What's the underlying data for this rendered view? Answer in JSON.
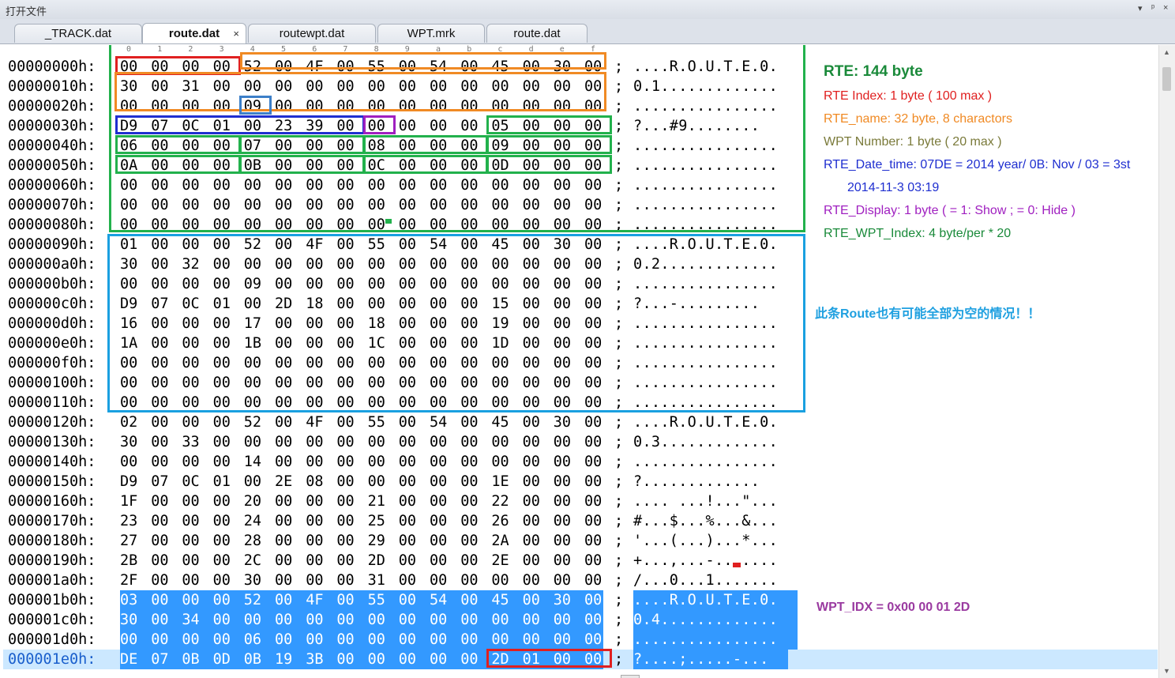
{
  "window": {
    "title": "打开文件",
    "controls": "▾ ᵖ ×"
  },
  "tabs": [
    {
      "label": "_TRACK.dat",
      "active": false
    },
    {
      "label": "route.dat",
      "active": true,
      "close": "×"
    },
    {
      "label": "routewpt.dat",
      "active": false
    },
    {
      "label": "WPT.mrk",
      "active": false
    },
    {
      "label": "route.dat",
      "active": false
    }
  ],
  "ruler": [
    "0",
    "1",
    "2",
    "3",
    "4",
    "5",
    "6",
    "7",
    "8",
    "9",
    "a",
    "b",
    "c",
    "d",
    "e",
    "f"
  ],
  "hex_rows": [
    {
      "addr": "00000000h:",
      "bytes": [
        "00",
        "00",
        "00",
        "00",
        "52",
        "00",
        "4F",
        "00",
        "55",
        "00",
        "54",
        "00",
        "45",
        "00",
        "30",
        "00"
      ],
      "ascii": "....R.O.U.T.E.0."
    },
    {
      "addr": "00000010h:",
      "bytes": [
        "30",
        "00",
        "31",
        "00",
        "00",
        "00",
        "00",
        "00",
        "00",
        "00",
        "00",
        "00",
        "00",
        "00",
        "00",
        "00"
      ],
      "ascii": "0.1............."
    },
    {
      "addr": "00000020h:",
      "bytes": [
        "00",
        "00",
        "00",
        "00",
        "09",
        "00",
        "00",
        "00",
        "00",
        "00",
        "00",
        "00",
        "00",
        "00",
        "00",
        "00"
      ],
      "ascii": "................"
    },
    {
      "addr": "00000030h:",
      "bytes": [
        "D9",
        "07",
        "0C",
        "01",
        "00",
        "23",
        "39",
        "00",
        "00",
        "00",
        "00",
        "00",
        "05",
        "00",
        "00",
        "00"
      ],
      "ascii": "?...#9........"
    },
    {
      "addr": "00000040h:",
      "bytes": [
        "06",
        "00",
        "00",
        "00",
        "07",
        "00",
        "00",
        "00",
        "08",
        "00",
        "00",
        "00",
        "09",
        "00",
        "00",
        "00"
      ],
      "ascii": "................"
    },
    {
      "addr": "00000050h:",
      "bytes": [
        "0A",
        "00",
        "00",
        "00",
        "0B",
        "00",
        "00",
        "00",
        "0C",
        "00",
        "00",
        "00",
        "0D",
        "00",
        "00",
        "00"
      ],
      "ascii": "................"
    },
    {
      "addr": "00000060h:",
      "bytes": [
        "00",
        "00",
        "00",
        "00",
        "00",
        "00",
        "00",
        "00",
        "00",
        "00",
        "00",
        "00",
        "00",
        "00",
        "00",
        "00"
      ],
      "ascii": "................"
    },
    {
      "addr": "00000070h:",
      "bytes": [
        "00",
        "00",
        "00",
        "00",
        "00",
        "00",
        "00",
        "00",
        "00",
        "00",
        "00",
        "00",
        "00",
        "00",
        "00",
        "00"
      ],
      "ascii": "................"
    },
    {
      "addr": "00000080h:",
      "bytes": [
        "00",
        "00",
        "00",
        "00",
        "00",
        "00",
        "00",
        "00",
        "00",
        "00",
        "00",
        "00",
        "00",
        "00",
        "00",
        "00"
      ],
      "ascii": "................"
    },
    {
      "addr": "00000090h:",
      "bytes": [
        "01",
        "00",
        "00",
        "00",
        "52",
        "00",
        "4F",
        "00",
        "55",
        "00",
        "54",
        "00",
        "45",
        "00",
        "30",
        "00"
      ],
      "ascii": "....R.O.U.T.E.0."
    },
    {
      "addr": "000000a0h:",
      "bytes": [
        "30",
        "00",
        "32",
        "00",
        "00",
        "00",
        "00",
        "00",
        "00",
        "00",
        "00",
        "00",
        "00",
        "00",
        "00",
        "00"
      ],
      "ascii": "0.2............."
    },
    {
      "addr": "000000b0h:",
      "bytes": [
        "00",
        "00",
        "00",
        "00",
        "09",
        "00",
        "00",
        "00",
        "00",
        "00",
        "00",
        "00",
        "00",
        "00",
        "00",
        "00"
      ],
      "ascii": "................"
    },
    {
      "addr": "000000c0h:",
      "bytes": [
        "D9",
        "07",
        "0C",
        "01",
        "00",
        "2D",
        "18",
        "00",
        "00",
        "00",
        "00",
        "00",
        "15",
        "00",
        "00",
        "00"
      ],
      "ascii": "?...-........."
    },
    {
      "addr": "000000d0h:",
      "bytes": [
        "16",
        "00",
        "00",
        "00",
        "17",
        "00",
        "00",
        "00",
        "18",
        "00",
        "00",
        "00",
        "19",
        "00",
        "00",
        "00"
      ],
      "ascii": "................"
    },
    {
      "addr": "000000e0h:",
      "bytes": [
        "1A",
        "00",
        "00",
        "00",
        "1B",
        "00",
        "00",
        "00",
        "1C",
        "00",
        "00",
        "00",
        "1D",
        "00",
        "00",
        "00"
      ],
      "ascii": "................"
    },
    {
      "addr": "000000f0h:",
      "bytes": [
        "00",
        "00",
        "00",
        "00",
        "00",
        "00",
        "00",
        "00",
        "00",
        "00",
        "00",
        "00",
        "00",
        "00",
        "00",
        "00"
      ],
      "ascii": "................"
    },
    {
      "addr": "00000100h:",
      "bytes": [
        "00",
        "00",
        "00",
        "00",
        "00",
        "00",
        "00",
        "00",
        "00",
        "00",
        "00",
        "00",
        "00",
        "00",
        "00",
        "00"
      ],
      "ascii": "................"
    },
    {
      "addr": "00000110h:",
      "bytes": [
        "00",
        "00",
        "00",
        "00",
        "00",
        "00",
        "00",
        "00",
        "00",
        "00",
        "00",
        "00",
        "00",
        "00",
        "00",
        "00"
      ],
      "ascii": "................"
    },
    {
      "addr": "00000120h:",
      "bytes": [
        "02",
        "00",
        "00",
        "00",
        "52",
        "00",
        "4F",
        "00",
        "55",
        "00",
        "54",
        "00",
        "45",
        "00",
        "30",
        "00"
      ],
      "ascii": "....R.O.U.T.E.0."
    },
    {
      "addr": "00000130h:",
      "bytes": [
        "30",
        "00",
        "33",
        "00",
        "00",
        "00",
        "00",
        "00",
        "00",
        "00",
        "00",
        "00",
        "00",
        "00",
        "00",
        "00"
      ],
      "ascii": "0.3............."
    },
    {
      "addr": "00000140h:",
      "bytes": [
        "00",
        "00",
        "00",
        "00",
        "14",
        "00",
        "00",
        "00",
        "00",
        "00",
        "00",
        "00",
        "00",
        "00",
        "00",
        "00"
      ],
      "ascii": "................"
    },
    {
      "addr": "00000150h:",
      "bytes": [
        "D9",
        "07",
        "0C",
        "01",
        "00",
        "2E",
        "08",
        "00",
        "00",
        "00",
        "00",
        "00",
        "1E",
        "00",
        "00",
        "00"
      ],
      "ascii": "?............."
    },
    {
      "addr": "00000160h:",
      "bytes": [
        "1F",
        "00",
        "00",
        "00",
        "20",
        "00",
        "00",
        "00",
        "21",
        "00",
        "00",
        "00",
        "22",
        "00",
        "00",
        "00"
      ],
      "ascii": ".... ...!...\"..."
    },
    {
      "addr": "00000170h:",
      "bytes": [
        "23",
        "00",
        "00",
        "00",
        "24",
        "00",
        "00",
        "00",
        "25",
        "00",
        "00",
        "00",
        "26",
        "00",
        "00",
        "00"
      ],
      "ascii": "#...$...%...&..."
    },
    {
      "addr": "00000180h:",
      "bytes": [
        "27",
        "00",
        "00",
        "00",
        "28",
        "00",
        "00",
        "00",
        "29",
        "00",
        "00",
        "00",
        "2A",
        "00",
        "00",
        "00"
      ],
      "ascii": "'...(...)...*..."
    },
    {
      "addr": "00000190h:",
      "bytes": [
        "2B",
        "00",
        "00",
        "00",
        "2C",
        "00",
        "00",
        "00",
        "2D",
        "00",
        "00",
        "00",
        "2E",
        "00",
        "00",
        "00"
      ],
      "ascii": "+...,...-......."
    },
    {
      "addr": "000001a0h:",
      "bytes": [
        "2F",
        "00",
        "00",
        "00",
        "30",
        "00",
        "00",
        "00",
        "31",
        "00",
        "00",
        "00",
        "00",
        "00",
        "00",
        "00"
      ],
      "ascii": "/...0...1......."
    },
    {
      "addr": "000001b0h:",
      "bytes": [
        "03",
        "00",
        "00",
        "00",
        "52",
        "00",
        "4F",
        "00",
        "55",
        "00",
        "54",
        "00",
        "45",
        "00",
        "30",
        "00"
      ],
      "ascii": "....R.O.U.T.E.0."
    },
    {
      "addr": "000001c0h:",
      "bytes": [
        "30",
        "00",
        "34",
        "00",
        "00",
        "00",
        "00",
        "00",
        "00",
        "00",
        "00",
        "00",
        "00",
        "00",
        "00",
        "00"
      ],
      "ascii": "0.4............."
    },
    {
      "addr": "000001d0h:",
      "bytes": [
        "00",
        "00",
        "00",
        "00",
        "06",
        "00",
        "00",
        "00",
        "00",
        "00",
        "00",
        "00",
        "00",
        "00",
        "00",
        "00"
      ],
      "ascii": "................"
    },
    {
      "addr": "000001e0h:",
      "bytes": [
        "DE",
        "07",
        "0B",
        "0D",
        "0B",
        "19",
        "3B",
        "00",
        "00",
        "00",
        "00",
        "00",
        "2D",
        "01",
        "00",
        "00"
      ],
      "ascii": "?....;.....-..."
    }
  ],
  "selection": {
    "from_row": 27,
    "to_row": 30,
    "cursor_row": 30,
    "color": "#3399ff"
  },
  "annotations": {
    "rte_size": {
      "text": "RTE: 144 byte",
      "color": "#1a8a3a"
    },
    "rte_index": {
      "text": "RTE Index: 1 byte ( 100 max )",
      "color": "#e02020"
    },
    "rte_name": {
      "text": "RTE_name: 32 byte, 8 charactors",
      "color": "#f08a24"
    },
    "wpt_number": {
      "text": "WPT Number: 1 byte ( 20 max )",
      "color": "#7a7a3a"
    },
    "rte_date_time": {
      "text": "RTE_Date_time: 07DE = 2014 year/ 0B: Nov / 03 = 3st",
      "color": "#1f2fd0"
    },
    "rte_date_value": {
      "text": "2014-11-3 03:19",
      "color": "#1f2fd0"
    },
    "rte_display": {
      "text": "RTE_Display:  1 byte ( = 1: Show ; = 0: Hide )",
      "color": "#a020c0"
    },
    "rte_wpt_index": {
      "text": "RTE_WPT_Index:  4 byte/per * 20",
      "color": "#1a8a3a"
    },
    "empty_note": {
      "text": "此条Route也有可能全部为空的情况！！",
      "color": "#1fa0e0"
    },
    "wpt_idx": {
      "text": "WPT_IDX = 0x00 00 01 2D",
      "color": "#9a3aa0"
    }
  },
  "colors": {
    "green": "#22b14c",
    "red": "#e02020",
    "orange": "#f08a24",
    "blue": "#1f2fd0",
    "lightblue": "#3c7fc8",
    "purple": "#a020c0",
    "cyan": "#1aa0e0"
  },
  "icons": {
    "magnifier": "magnifier-icon"
  }
}
